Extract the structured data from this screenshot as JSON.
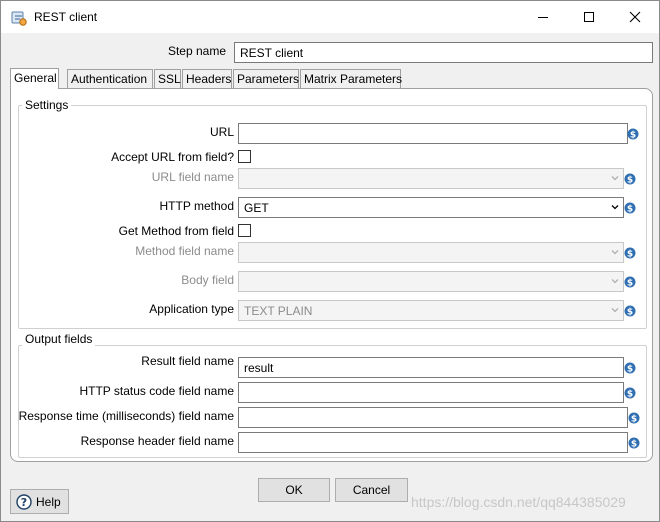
{
  "window": {
    "title": "REST client"
  },
  "step_name": {
    "label": "Step name",
    "value": "REST client"
  },
  "tabs": [
    {
      "label": "General",
      "active": true
    },
    {
      "label": "Authentication",
      "active": false
    },
    {
      "label": "SSL",
      "active": false
    },
    {
      "label": "Headers",
      "active": false
    },
    {
      "label": "Parameters",
      "active": false
    },
    {
      "label": "Matrix Parameters",
      "active": false
    }
  ],
  "settings": {
    "title": "Settings",
    "url": {
      "label": "URL",
      "value": ""
    },
    "accept_url_from_field": {
      "label": "Accept URL from field?",
      "checked": false
    },
    "url_field_name": {
      "label": "URL field name",
      "value": ""
    },
    "http_method": {
      "label": "HTTP method",
      "value": "GET"
    },
    "get_method_from_field": {
      "label": "Get Method from field",
      "checked": false
    },
    "method_field_name": {
      "label": "Method field name",
      "value": ""
    },
    "body_field": {
      "label": "Body field",
      "value": ""
    },
    "application_type": {
      "label": "Application type",
      "value": "TEXT PLAIN"
    }
  },
  "output_fields": {
    "title": "Output fields",
    "result_field_name": {
      "label": "Result field name",
      "value": "result"
    },
    "http_status_code_field_name": {
      "label": "HTTP status code field name",
      "value": ""
    },
    "response_time_field_name": {
      "label": "Response time (milliseconds) field name",
      "value": ""
    },
    "response_header_field_name": {
      "label": "Response header field name",
      "value": ""
    }
  },
  "buttons": {
    "ok": "OK",
    "cancel": "Cancel",
    "help": "Help"
  },
  "watermark": "https://blog.csdn.net/qq844385029",
  "colors": {
    "variable_icon": "#2f6fb1",
    "titlebar": "#ffffff",
    "dialog_bg": "#f0f0f0"
  },
  "icons": {
    "app": "rest-client-app-icon",
    "variable": "dollar-variable-icon",
    "help": "question-circle-icon"
  }
}
